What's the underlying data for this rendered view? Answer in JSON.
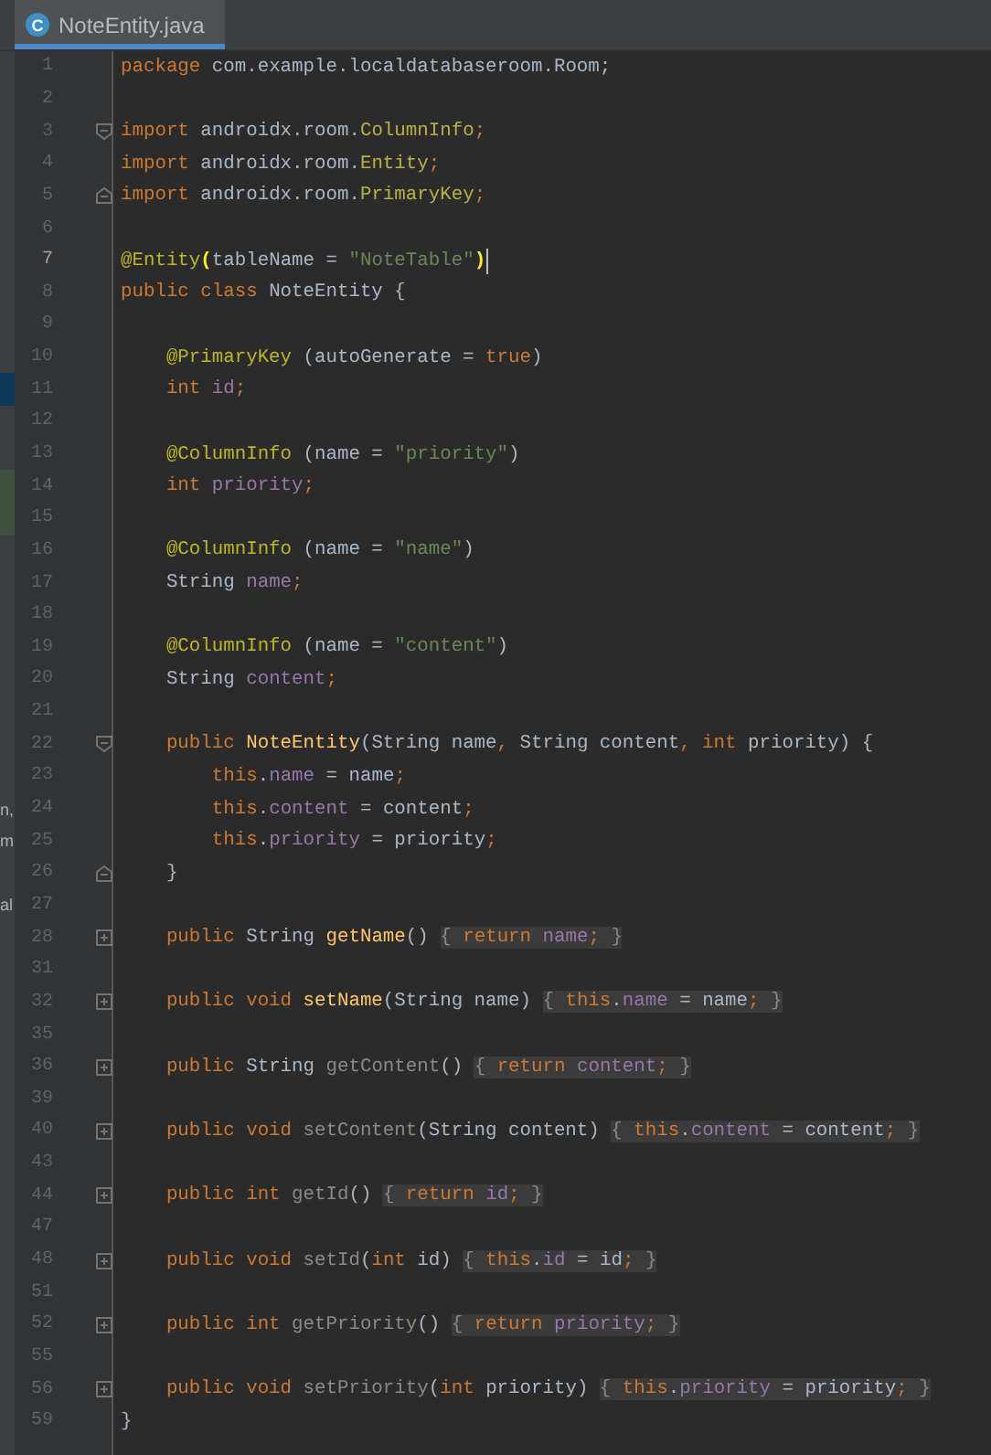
{
  "tab": {
    "icon_letter": "C",
    "title": "NoteEntity.java",
    "selected": true
  },
  "lines": [
    {
      "number": "1",
      "tokens": [
        {
          "kind": "keyword",
          "text": "package"
        },
        {
          "kind": "plain",
          "text": " com.example.localdatabaseroom.Room;"
        }
      ]
    },
    {
      "number": "2"
    },
    {
      "number": "3",
      "fold_start": true,
      "tokens": [
        {
          "kind": "keyword",
          "text": "import"
        },
        {
          "kind": "plain",
          "text": " androidx.room."
        },
        {
          "kind": "class",
          "text": "ColumnInfo"
        },
        {
          "kind": "semi",
          "text": ";"
        }
      ]
    },
    {
      "number": "4",
      "tokens": [
        {
          "kind": "keyword",
          "text": "import"
        },
        {
          "kind": "plain",
          "text": " androidx.room."
        },
        {
          "kind": "class",
          "text": "Entity"
        },
        {
          "kind": "semi",
          "text": ";"
        }
      ]
    },
    {
      "number": "5",
      "fold_end": true,
      "tokens": [
        {
          "kind": "keyword",
          "text": "import"
        },
        {
          "kind": "plain",
          "text": " androidx.room."
        },
        {
          "kind": "class",
          "text": "PrimaryKey"
        },
        {
          "kind": "semi",
          "text": ";"
        }
      ]
    },
    {
      "number": "6"
    },
    {
      "number": "7",
      "current": true,
      "caret": true,
      "tokens": [
        {
          "kind": "annotation",
          "text": "@Entity"
        },
        {
          "kind": "match",
          "text": "("
        },
        {
          "kind": "plain",
          "text": "tableName = "
        },
        {
          "kind": "string",
          "text": "\"NoteTable\""
        },
        {
          "kind": "match",
          "text": ")"
        }
      ]
    },
    {
      "number": "8",
      "tokens": [
        {
          "kind": "keyword",
          "text": "public class "
        },
        {
          "kind": "plain",
          "text": "NoteEntity {"
        }
      ]
    },
    {
      "number": "9"
    },
    {
      "number": "10",
      "tokens": [
        {
          "kind": "annotation",
          "text": "    @PrimaryKey"
        },
        {
          "kind": "plain",
          "text": " (autoGenerate = "
        },
        {
          "kind": "keyword",
          "text": "true"
        },
        {
          "kind": "plain",
          "text": ")"
        }
      ]
    },
    {
      "number": "11",
      "side_selected": true,
      "tokens": [
        {
          "kind": "keyword",
          "text": "    int "
        },
        {
          "kind": "field",
          "text": "id"
        },
        {
          "kind": "semi",
          "text": ";"
        }
      ]
    },
    {
      "number": "12"
    },
    {
      "number": "13",
      "tokens": [
        {
          "kind": "annotation",
          "text": "    @ColumnInfo"
        },
        {
          "kind": "plain",
          "text": " (name = "
        },
        {
          "kind": "string",
          "text": "\"priority\""
        },
        {
          "kind": "plain",
          "text": ")"
        }
      ]
    },
    {
      "number": "14",
      "side_changed": true,
      "tokens": [
        {
          "kind": "keyword",
          "text": "    int "
        },
        {
          "kind": "field",
          "text": "priority"
        },
        {
          "kind": "semi",
          "text": ";"
        }
      ]
    },
    {
      "number": "15",
      "side_changed": true
    },
    {
      "number": "16",
      "tokens": [
        {
          "kind": "annotation",
          "text": "    @ColumnInfo"
        },
        {
          "kind": "plain",
          "text": " (name = "
        },
        {
          "kind": "string",
          "text": "\"name\""
        },
        {
          "kind": "plain",
          "text": ")"
        }
      ]
    },
    {
      "number": "17",
      "tokens": [
        {
          "kind": "plain",
          "text": "    String "
        },
        {
          "kind": "field",
          "text": "name"
        },
        {
          "kind": "semi",
          "text": ";"
        }
      ]
    },
    {
      "number": "18"
    },
    {
      "number": "19",
      "tokens": [
        {
          "kind": "annotation",
          "text": "    @ColumnInfo"
        },
        {
          "kind": "plain",
          "text": " (name = "
        },
        {
          "kind": "string",
          "text": "\"content\""
        },
        {
          "kind": "plain",
          "text": ")"
        }
      ]
    },
    {
      "number": "20",
      "tokens": [
        {
          "kind": "plain",
          "text": "    String "
        },
        {
          "kind": "field",
          "text": "content"
        },
        {
          "kind": "semi",
          "text": ";"
        }
      ]
    },
    {
      "number": "21"
    },
    {
      "number": "22",
      "fold_start": true,
      "tokens": [
        {
          "kind": "keyword",
          "text": "    public "
        },
        {
          "kind": "method",
          "text": "NoteEntity"
        },
        {
          "kind": "plain",
          "text": "(String name"
        },
        {
          "kind": "semi",
          "text": ","
        },
        {
          "kind": "plain",
          "text": " String content"
        },
        {
          "kind": "semi",
          "text": ","
        },
        {
          "kind": "keyword",
          "text": " int "
        },
        {
          "kind": "plain",
          "text": "priority) {"
        }
      ]
    },
    {
      "number": "23",
      "tokens": [
        {
          "kind": "keyword",
          "text": "        this"
        },
        {
          "kind": "plain",
          "text": "."
        },
        {
          "kind": "field",
          "text": "name"
        },
        {
          "kind": "plain",
          "text": " = name"
        },
        {
          "kind": "semi",
          "text": ";"
        }
      ]
    },
    {
      "number": "24",
      "side_text": "n,",
      "tokens": [
        {
          "kind": "keyword",
          "text": "        this"
        },
        {
          "kind": "plain",
          "text": "."
        },
        {
          "kind": "field",
          "text": "content"
        },
        {
          "kind": "plain",
          "text": " = content"
        },
        {
          "kind": "semi",
          "text": ";"
        }
      ]
    },
    {
      "number": "25",
      "side_text": "m",
      "tokens": [
        {
          "kind": "keyword",
          "text": "        this"
        },
        {
          "kind": "plain",
          "text": "."
        },
        {
          "kind": "field",
          "text": "priority"
        },
        {
          "kind": "plain",
          "text": " = priority"
        },
        {
          "kind": "semi",
          "text": ";"
        }
      ]
    },
    {
      "number": "26",
      "fold_end": true,
      "tokens": [
        {
          "kind": "plain",
          "text": "    }"
        }
      ]
    },
    {
      "number": "27",
      "side_text": "al"
    },
    {
      "number": "28",
      "collapsed": true,
      "tokens": [
        {
          "kind": "keyword",
          "text": "    public "
        },
        {
          "kind": "plain",
          "text": "String "
        },
        {
          "kind": "method",
          "text": "getName"
        },
        {
          "kind": "plain",
          "text": "() "
        },
        {
          "kind": "folded",
          "parts": [
            {
              "kind": "dim",
              "text": "{ "
            },
            {
              "kind": "keyword",
              "text": "return "
            },
            {
              "kind": "field",
              "text": "name"
            },
            {
              "kind": "semi",
              "text": ";"
            },
            {
              "kind": "dim",
              "text": " }"
            }
          ]
        }
      ]
    },
    {
      "number": "31"
    },
    {
      "number": "32",
      "collapsed": true,
      "tokens": [
        {
          "kind": "keyword",
          "text": "    public void "
        },
        {
          "kind": "method",
          "text": "setName"
        },
        {
          "kind": "plain",
          "text": "(String name) "
        },
        {
          "kind": "folded",
          "parts": [
            {
              "kind": "dim",
              "text": "{ "
            },
            {
              "kind": "keyword",
              "text": "this"
            },
            {
              "kind": "plain",
              "text": "."
            },
            {
              "kind": "field",
              "text": "name"
            },
            {
              "kind": "plain",
              "text": " = name"
            },
            {
              "kind": "semi",
              "text": ";"
            },
            {
              "kind": "dim",
              "text": " }"
            }
          ]
        }
      ]
    },
    {
      "number": "35"
    },
    {
      "number": "36",
      "collapsed": true,
      "tokens": [
        {
          "kind": "keyword",
          "text": "    public "
        },
        {
          "kind": "plain",
          "text": "String "
        },
        {
          "kind": "unused",
          "text": "getContent"
        },
        {
          "kind": "plain",
          "text": "() "
        },
        {
          "kind": "folded",
          "parts": [
            {
              "kind": "dim",
              "text": "{ "
            },
            {
              "kind": "keyword",
              "text": "return "
            },
            {
              "kind": "field",
              "text": "content"
            },
            {
              "kind": "semi",
              "text": ";"
            },
            {
              "kind": "dim",
              "text": " }"
            }
          ]
        }
      ]
    },
    {
      "number": "39"
    },
    {
      "number": "40",
      "collapsed": true,
      "tokens": [
        {
          "kind": "keyword",
          "text": "    public void "
        },
        {
          "kind": "unused",
          "text": "setContent"
        },
        {
          "kind": "plain",
          "text": "(String content) "
        },
        {
          "kind": "folded",
          "parts": [
            {
              "kind": "dim",
              "text": "{ "
            },
            {
              "kind": "keyword",
              "text": "this"
            },
            {
              "kind": "plain",
              "text": "."
            },
            {
              "kind": "field",
              "text": "content"
            },
            {
              "kind": "plain",
              "text": " = content"
            },
            {
              "kind": "semi",
              "text": ";"
            },
            {
              "kind": "dim",
              "text": " }"
            }
          ]
        }
      ]
    },
    {
      "number": "43"
    },
    {
      "number": "44",
      "collapsed": true,
      "tokens": [
        {
          "kind": "keyword",
          "text": "    public int "
        },
        {
          "kind": "unused",
          "text": "getId"
        },
        {
          "kind": "plain",
          "text": "() "
        },
        {
          "kind": "folded",
          "parts": [
            {
              "kind": "dim",
              "text": "{ "
            },
            {
              "kind": "keyword",
              "text": "return "
            },
            {
              "kind": "field",
              "text": "id"
            },
            {
              "kind": "semi",
              "text": ";"
            },
            {
              "kind": "dim",
              "text": " }"
            }
          ]
        }
      ]
    },
    {
      "number": "47"
    },
    {
      "number": "48",
      "collapsed": true,
      "tokens": [
        {
          "kind": "keyword",
          "text": "    public void "
        },
        {
          "kind": "unused",
          "text": "setId"
        },
        {
          "kind": "plain",
          "text": "("
        },
        {
          "kind": "keyword",
          "text": "int "
        },
        {
          "kind": "plain",
          "text": "id) "
        },
        {
          "kind": "folded",
          "parts": [
            {
              "kind": "dim",
              "text": "{ "
            },
            {
              "kind": "keyword",
              "text": "this"
            },
            {
              "kind": "plain",
              "text": "."
            },
            {
              "kind": "field",
              "text": "id"
            },
            {
              "kind": "plain",
              "text": " = id"
            },
            {
              "kind": "semi",
              "text": ";"
            },
            {
              "kind": "dim",
              "text": " }"
            }
          ]
        }
      ]
    },
    {
      "number": "51"
    },
    {
      "number": "52",
      "collapsed": true,
      "tokens": [
        {
          "kind": "keyword",
          "text": "    public int "
        },
        {
          "kind": "unused",
          "text": "getPriority"
        },
        {
          "kind": "plain",
          "text": "() "
        },
        {
          "kind": "folded",
          "parts": [
            {
              "kind": "dim",
              "text": "{ "
            },
            {
              "kind": "keyword",
              "text": "return "
            },
            {
              "kind": "field",
              "text": "priority"
            },
            {
              "kind": "semi",
              "text": ";"
            },
            {
              "kind": "dim",
              "text": " }"
            }
          ]
        }
      ]
    },
    {
      "number": "55"
    },
    {
      "number": "56",
      "collapsed": true,
      "tokens": [
        {
          "kind": "keyword",
          "text": "    public void "
        },
        {
          "kind": "unused",
          "text": "setPriority"
        },
        {
          "kind": "plain",
          "text": "("
        },
        {
          "kind": "keyword",
          "text": "int "
        },
        {
          "kind": "plain",
          "text": "priority) "
        },
        {
          "kind": "folded",
          "parts": [
            {
              "kind": "dim",
              "text": "{ "
            },
            {
              "kind": "keyword",
              "text": "this"
            },
            {
              "kind": "plain",
              "text": "."
            },
            {
              "kind": "field",
              "text": "priority"
            },
            {
              "kind": "plain",
              "text": " = priority"
            },
            {
              "kind": "semi",
              "text": ";"
            },
            {
              "kind": "dim",
              "text": " }"
            }
          ]
        }
      ]
    },
    {
      "number": "59",
      "tokens": [
        {
          "kind": "plain",
          "text": "}"
        }
      ]
    }
  ]
}
